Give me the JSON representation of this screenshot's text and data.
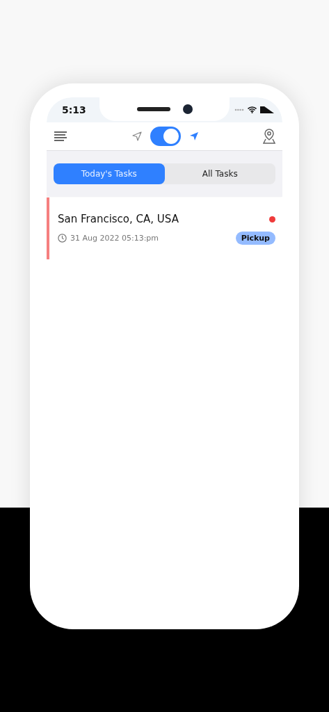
{
  "status_bar": {
    "time": "5:13"
  },
  "header": {
    "location_toggle": {
      "on": true
    }
  },
  "tabs": [
    {
      "label": "Today's Tasks",
      "selected": true
    },
    {
      "label": "All Tasks",
      "selected": false
    }
  ],
  "tasks": [
    {
      "address": "San Francisco, CA, USA",
      "datetime": "31 Aug 2022 05:13:pm",
      "tag": "Pickup",
      "color": "#ef3b3b"
    }
  ]
}
